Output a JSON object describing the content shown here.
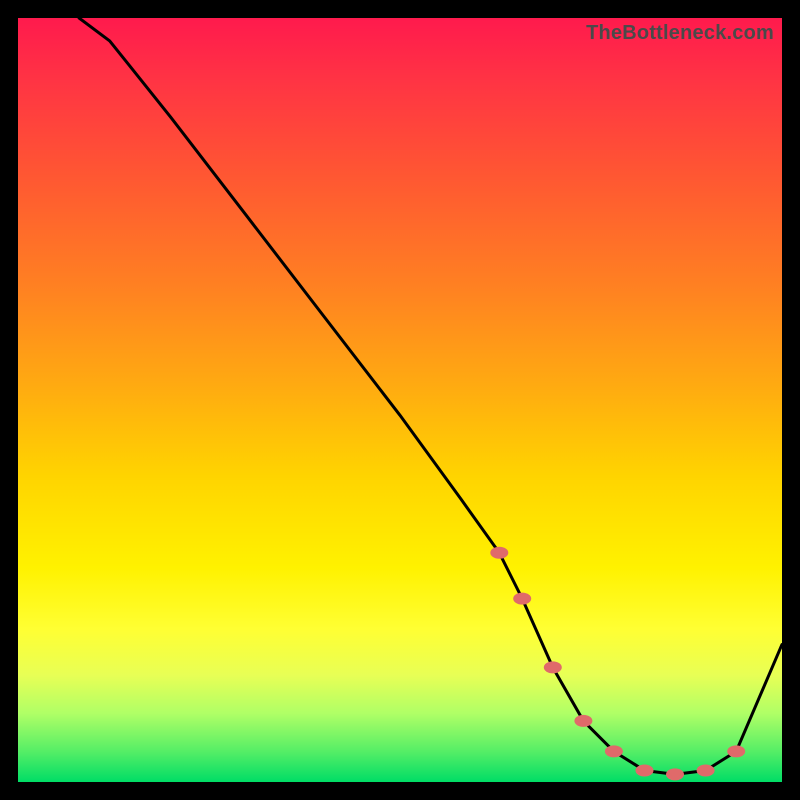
{
  "watermark": "TheBottleneck.com",
  "chart_data": {
    "type": "line",
    "title": "",
    "xlabel": "",
    "ylabel": "",
    "xlim": [
      0,
      100
    ],
    "ylim": [
      0,
      100
    ],
    "curve": {
      "x": [
        8,
        12,
        20,
        30,
        40,
        50,
        58,
        63,
        66,
        70,
        74,
        78,
        82,
        86,
        90,
        94,
        100
      ],
      "y": [
        100,
        97,
        87,
        74,
        61,
        48,
        37,
        30,
        24,
        15,
        8,
        4,
        1.5,
        1,
        1.5,
        4,
        18
      ]
    },
    "markers": {
      "x": [
        63,
        66,
        70,
        74,
        78,
        82,
        86,
        90,
        94
      ],
      "y": [
        30,
        24,
        15,
        8,
        4,
        1.5,
        1,
        1.5,
        4
      ],
      "color": "#e06a6a"
    }
  }
}
